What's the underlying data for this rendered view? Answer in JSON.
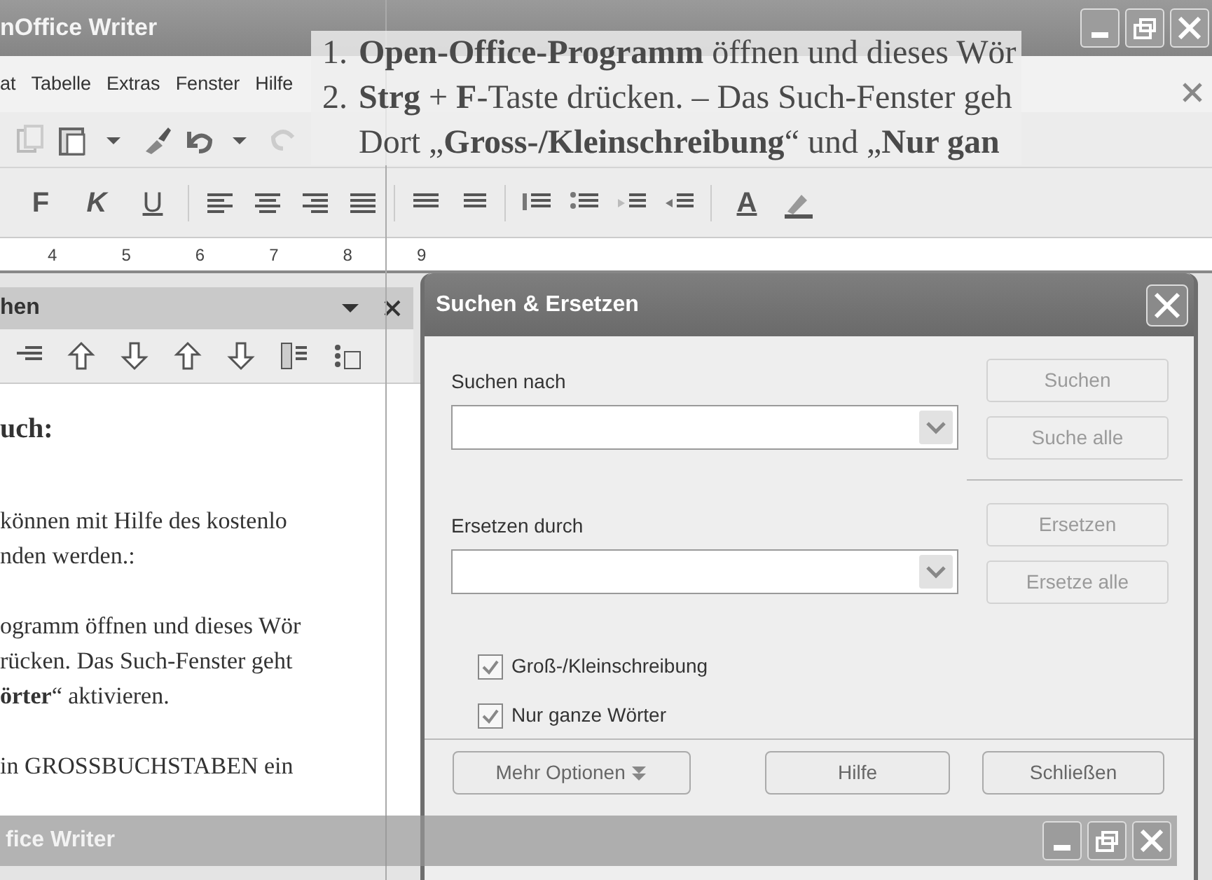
{
  "writer": {
    "title": "nOffice Writer",
    "menu": [
      "at",
      "Tabelle",
      "Extras",
      "Fenster",
      "Hilfe"
    ],
    "format_buttons": [
      "F",
      "K",
      "U"
    ],
    "font_color_label": "A",
    "ruler": [
      "4",
      "5",
      "6",
      "7",
      "8",
      "9"
    ],
    "navigator_title": "hen",
    "document": [
      {
        "kind": "heading",
        "lines": [
          "uch:"
        ]
      },
      {
        "kind": "body",
        "lines": [
          "können mit Hilfe des kostenlo",
          "nden werden.:"
        ]
      },
      {
        "kind": "body",
        "lines": [
          "ogramm öffnen und dieses Wör",
          "rücken. Das Such-Fenster geht",
          "**örter**“ aktivieren."
        ]
      },
      {
        "kind": "body",
        "lines": [
          "in GROSSBUCHSTABEN ein"
        ]
      }
    ]
  },
  "instructions": [
    {
      "number": "1.",
      "text": "**Open-Office-Programm** öffnen und dieses Wör"
    },
    {
      "number": "2.",
      "text": "**Strg** +  **F**-Taste drücken. – Das Such-Fenster geh"
    },
    {
      "text": "Dort „**Gross-/Kleinschreibung**“ und „**Nur gan**"
    }
  ],
  "dialog": {
    "title": "Suchen & Ersetzen",
    "fields": [
      {
        "label": "Suchen nach",
        "buttons": [
          {
            "label": "Suchen",
            "disabled": true
          },
          {
            "label": "Suche alle",
            "disabled": true
          }
        ]
      },
      {
        "label": "Ersetzen durch",
        "buttons": [
          {
            "label": "Ersetzen",
            "disabled": true
          },
          {
            "label": "Ersetze alle",
            "disabled": true
          }
        ]
      }
    ],
    "options": [
      {
        "label": "Groß-/Kleinschreibung",
        "checked": true
      },
      {
        "label": "Nur ganze Wörter",
        "checked": true
      }
    ],
    "footer": [
      {
        "label": "Mehr Optionen",
        "kind": "menu"
      },
      {
        "label": "Hilfe",
        "kind": "plain"
      },
      {
        "label": "Schließen",
        "kind": "plain"
      }
    ]
  },
  "taskbar": {
    "title": "fice Writer"
  }
}
